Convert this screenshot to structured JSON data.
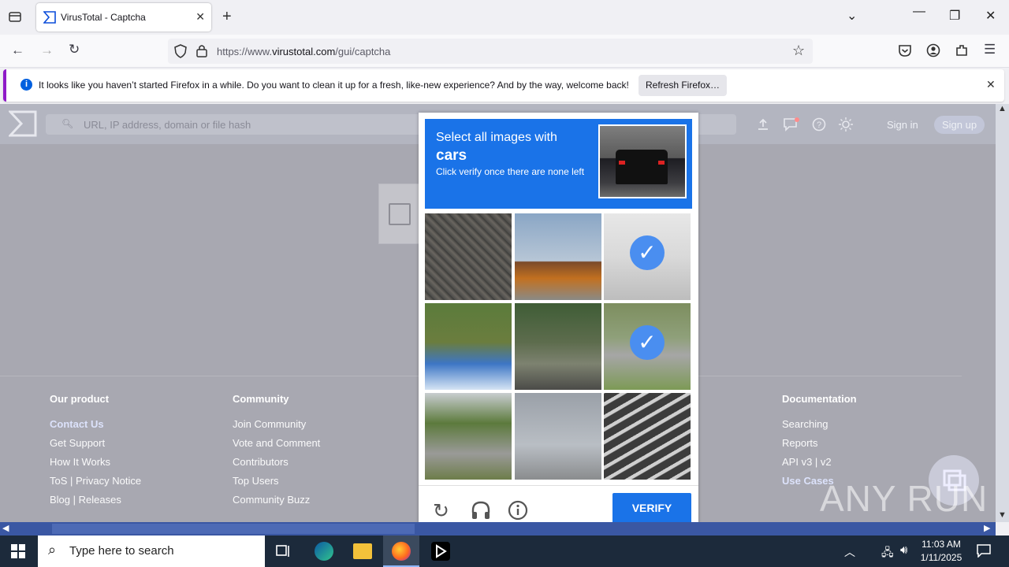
{
  "browser": {
    "tab_title": "VirusTotal - Captcha",
    "url_prefix": "https://www.",
    "url_host": "virustotal.com",
    "url_path": "/gui/captcha"
  },
  "notification": {
    "message": "It looks like you haven’t started Firefox in a while. Do you want to clean it up for a fresh, like-new experience? And by the way, welcome back!",
    "button": "Refresh Firefox…"
  },
  "vt_header": {
    "search_placeholder": "URL, IP address, domain or file hash",
    "sign_in": "Sign in",
    "sign_up": "Sign up"
  },
  "footer": {
    "our_product": {
      "title": "Our product",
      "links": [
        "Contact Us",
        "Get Support",
        "How It Works",
        "ToS | Privacy Notice",
        "Blog | Releases"
      ]
    },
    "community": {
      "title": "Community",
      "links": [
        "Join Community",
        "Vote and Comment",
        "Contributors",
        "Top Users",
        "Community Buzz"
      ]
    },
    "documentation": {
      "title": "Documentation",
      "links": [
        "Searching",
        "Reports",
        "API v3 | v2",
        "Use Cases"
      ]
    }
  },
  "captcha": {
    "line1": "Select all images with",
    "line2": "cars",
    "line3": "Click verify once there are none left",
    "verify": "VERIFY",
    "selected_tiles": [
      2,
      5
    ]
  },
  "watermark": "ANY RUN",
  "taskbar": {
    "search_placeholder": "Type here to search",
    "time": "11:03 AM",
    "date": "1/11/2025"
  },
  "colors": {
    "captcha_blue": "#1a73e8",
    "taskbar": "#1c2a3b",
    "firefox_accent": "#8f1ac8"
  }
}
